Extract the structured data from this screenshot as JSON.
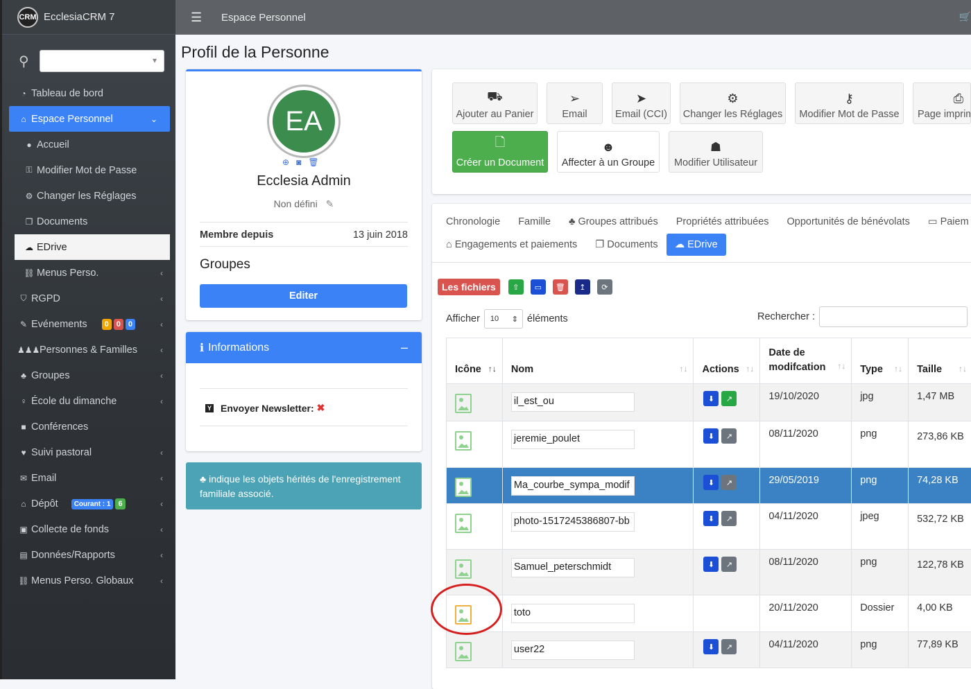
{
  "app": {
    "logo": "CRM",
    "title": "EcclesiaCRM 7"
  },
  "topbar": {
    "title": "Espace Personnel"
  },
  "sidebar": {
    "items": [
      {
        "label": "Tableau de bord",
        "icon": "dashboard-icon"
      },
      {
        "label": "Espace Personnel",
        "icon": "home-icon",
        "active": true
      },
      {
        "label": "Accueil",
        "icon": "user-icon"
      },
      {
        "label": "Modifier Mot de Passe",
        "icon": "key-icon"
      },
      {
        "label": "Changer les Réglages",
        "icon": "gear-icon"
      },
      {
        "label": "Documents",
        "icon": "documents-icon"
      },
      {
        "label": "EDrive",
        "icon": "cloud-icon",
        "current": true
      },
      {
        "label": "Menus Perso.",
        "icon": "link-icon"
      },
      {
        "label": "RGPD",
        "icon": "shield-icon"
      },
      {
        "label": "Evénements",
        "icon": "ticket-icon"
      },
      {
        "label": "Personnes & Familles",
        "icon": "family-icon"
      },
      {
        "label": "Groupes",
        "icon": "group-icon"
      },
      {
        "label": "École du dimanche",
        "icon": "child-icon"
      },
      {
        "label": "Conférences",
        "icon": "video-icon"
      },
      {
        "label": "Suivi pastoral",
        "icon": "heart-icon"
      },
      {
        "label": "Email",
        "icon": "envelope-icon"
      },
      {
        "label": "Dépôt",
        "icon": "bank-icon"
      },
      {
        "label": "Collecte de fonds",
        "icon": "money-icon"
      },
      {
        "label": "Données/Rapports",
        "icon": "report-icon"
      },
      {
        "label": "Menus Perso. Globaux",
        "icon": "link-icon"
      }
    ],
    "event_badges": [
      "0",
      "0",
      "0"
    ],
    "depot_badge": "Courant : 1",
    "depot_count": "6"
  },
  "page": {
    "title": "Profil de la Personne"
  },
  "profile": {
    "initials": "EA",
    "name": "Ecclesia Admin",
    "status": "Non défini",
    "member_label": "Membre depuis",
    "member_date": "13 juin 2018",
    "groups_title": "Groupes",
    "edit_label": "Editer"
  },
  "info": {
    "title": "Informations",
    "newsletter_label": "Envoyer Newsletter:",
    "newsletter_checkbox": "Y"
  },
  "callout": {
    "text": "indique les objets hérités de l'enregistrement familiale associé."
  },
  "actions": [
    {
      "label": "Ajouter au Panier",
      "icon": "cart-plus-icon"
    },
    {
      "label": "Email",
      "icon": "paper-plane-icon"
    },
    {
      "label": "Email (CCI)",
      "icon": "paper-plane-solid-icon"
    },
    {
      "label": "Changer les Réglages",
      "icon": "gear-icon"
    },
    {
      "label": "Modifier Mot de Passe",
      "icon": "key-icon"
    },
    {
      "label": "Page imprim",
      "icon": "printer-icon"
    },
    {
      "label": "Créer un Document",
      "icon": "file-icon"
    },
    {
      "label": "Affecter à un Groupe",
      "icon": "users-icon"
    },
    {
      "label": "Modifier Utilisateur",
      "icon": "user-secret-icon"
    }
  ],
  "tabs": {
    "row1": [
      "Chronologie",
      "Famille",
      "Groupes attribués",
      "Propriétés attribuées",
      "Opportunités de bénévolats",
      "Paiem"
    ],
    "row2": [
      "Engagements et paiements",
      "Documents",
      "EDrive"
    ]
  },
  "edrive": {
    "title": "Les fichiers",
    "show_label": "Afficher",
    "show_value": "10",
    "elements_label": "éléments",
    "search_label": "Rechercher :",
    "columns": [
      "Icône",
      "Nom",
      "Actions",
      "Date de modifcation",
      "Type",
      "Taille"
    ],
    "rows": [
      {
        "name": "il_est_ou",
        "date": "19/10/2020",
        "type": "jpg",
        "size": "1,47 MB",
        "folder": false
      },
      {
        "name": "jeremie_poulet",
        "date": "08/11/2020",
        "type": "png",
        "size": "273,86 KB",
        "folder": false
      },
      {
        "name": "Ma_courbe_sympa_modif",
        "date": "29/05/2019",
        "type": "png",
        "size": "74,28 KB",
        "folder": false
      },
      {
        "name": "photo-1517245386807-bb",
        "date": "04/11/2020",
        "type": "jpeg",
        "size": "532,72 KB",
        "folder": false
      },
      {
        "name": "Samuel_peterschmidt",
        "date": "08/11/2020",
        "type": "png",
        "size": "122,78 KB",
        "folder": false
      },
      {
        "name": "toto",
        "date": "20/11/2020",
        "type": "Dossier",
        "size": "4,00 KB",
        "folder": true
      },
      {
        "name": "user22",
        "date": "04/11/2020",
        "type": "png",
        "size": "77,89 KB",
        "folder": false
      }
    ]
  },
  "colors": {
    "primary": "#3b82f6",
    "success": "#4cae4c",
    "danger": "#d9534f",
    "info": "#4ba3b5"
  }
}
